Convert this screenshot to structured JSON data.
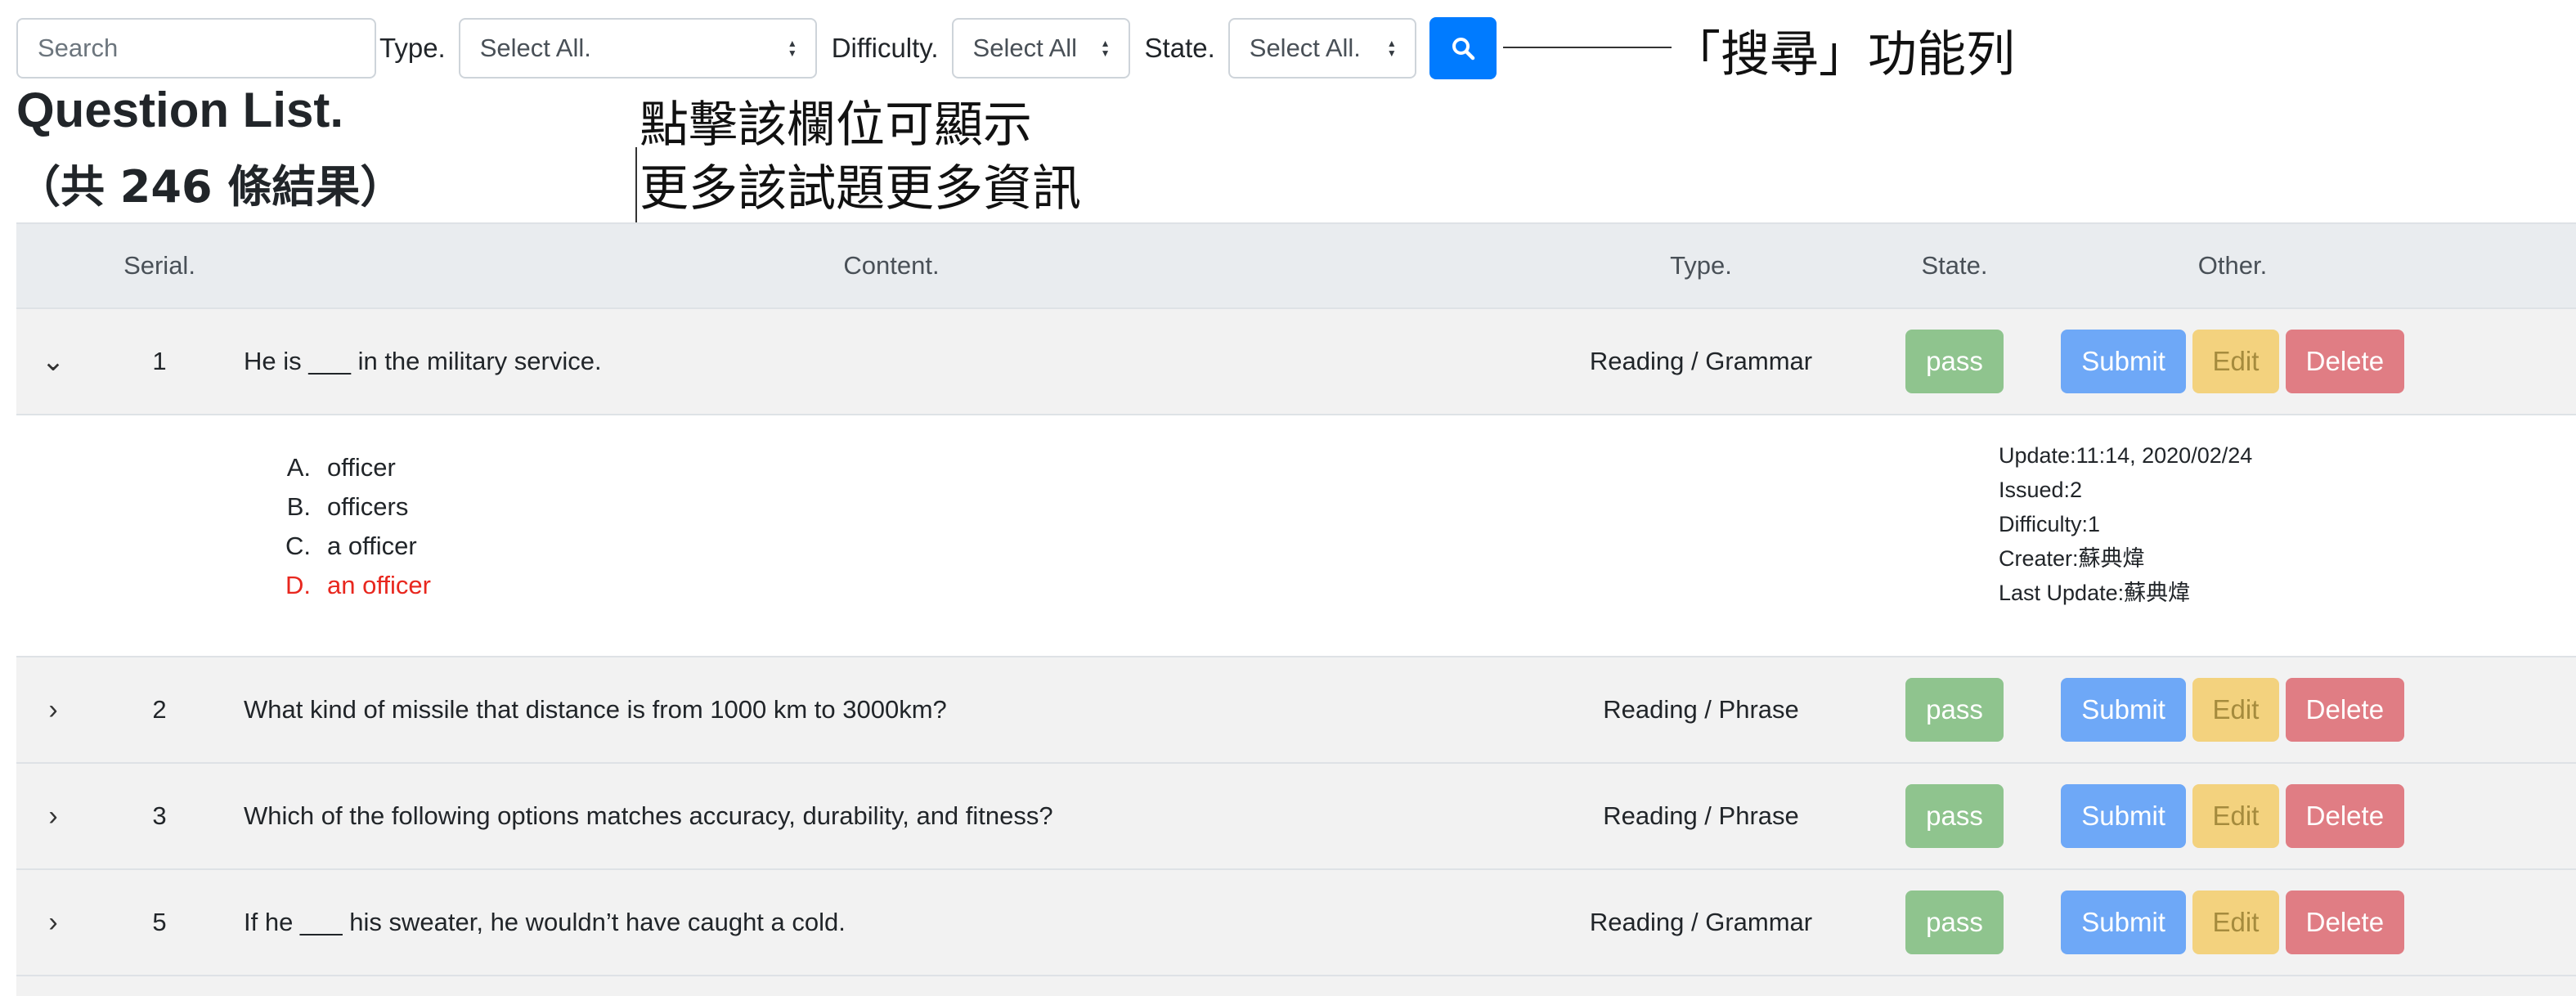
{
  "toolbar": {
    "search_placeholder": "Search",
    "type_label": "Type.",
    "type_value": "Select All.",
    "difficulty_label": "Difficulty.",
    "difficulty_value": "Select All",
    "state_label": "State.",
    "state_value": "Select All.",
    "search_icon": "search-icon",
    "accent": "#007bff"
  },
  "annotations": {
    "search_bar_note": "「搜尋」功能列",
    "expand_note_line1": "點擊該欄位可顯示",
    "expand_note_line2": "更多該試題更多資訊"
  },
  "page": {
    "title": "Question List.",
    "count": "（共 246 條結果）"
  },
  "table": {
    "headers": {
      "serial": "Serial.",
      "content": "Content.",
      "type": "Type.",
      "state": "State.",
      "other": "Other."
    },
    "actions": {
      "submit": "Submit",
      "edit": "Edit",
      "delete": "Delete"
    },
    "rows": [
      {
        "serial": "1",
        "content": "He is ___ in the military service.",
        "type": "Reading / Grammar",
        "state": "pass",
        "expanded": true,
        "options": [
          {
            "letter": "A.",
            "text": "officer",
            "correct": false
          },
          {
            "letter": "B.",
            "text": "officers",
            "correct": false
          },
          {
            "letter": "C.",
            "text": "a officer",
            "correct": false
          },
          {
            "letter": "D.",
            "text": "an officer",
            "correct": true
          }
        ],
        "meta": {
          "update": "Update:11:14, 2020/02/24",
          "issued": "Issued:2",
          "difficulty": "Difficulty:1",
          "creater": "Creater:蘇典煒",
          "last_update": "Last Update:蘇典煒"
        }
      },
      {
        "serial": "2",
        "content": "What kind of missile that distance is from 1000 km to 3000km?",
        "type": "Reading / Phrase",
        "state": "pass",
        "expanded": false
      },
      {
        "serial": "3",
        "content": "Which of the following options matches accuracy, durability, and fitness?",
        "type": "Reading / Phrase",
        "state": "pass",
        "expanded": false
      },
      {
        "serial": "5",
        "content": "If he ___ his sweater, he wouldn’t have caught a cold.",
        "type": "Reading / Grammar",
        "state": "pass",
        "expanded": false
      }
    ]
  },
  "colors": {
    "pass": "#8fc48e",
    "submit": "#6ea8f7",
    "edit": "#f3d27e",
    "delete": "#e07d84",
    "correct_answer": "#e8271e"
  }
}
